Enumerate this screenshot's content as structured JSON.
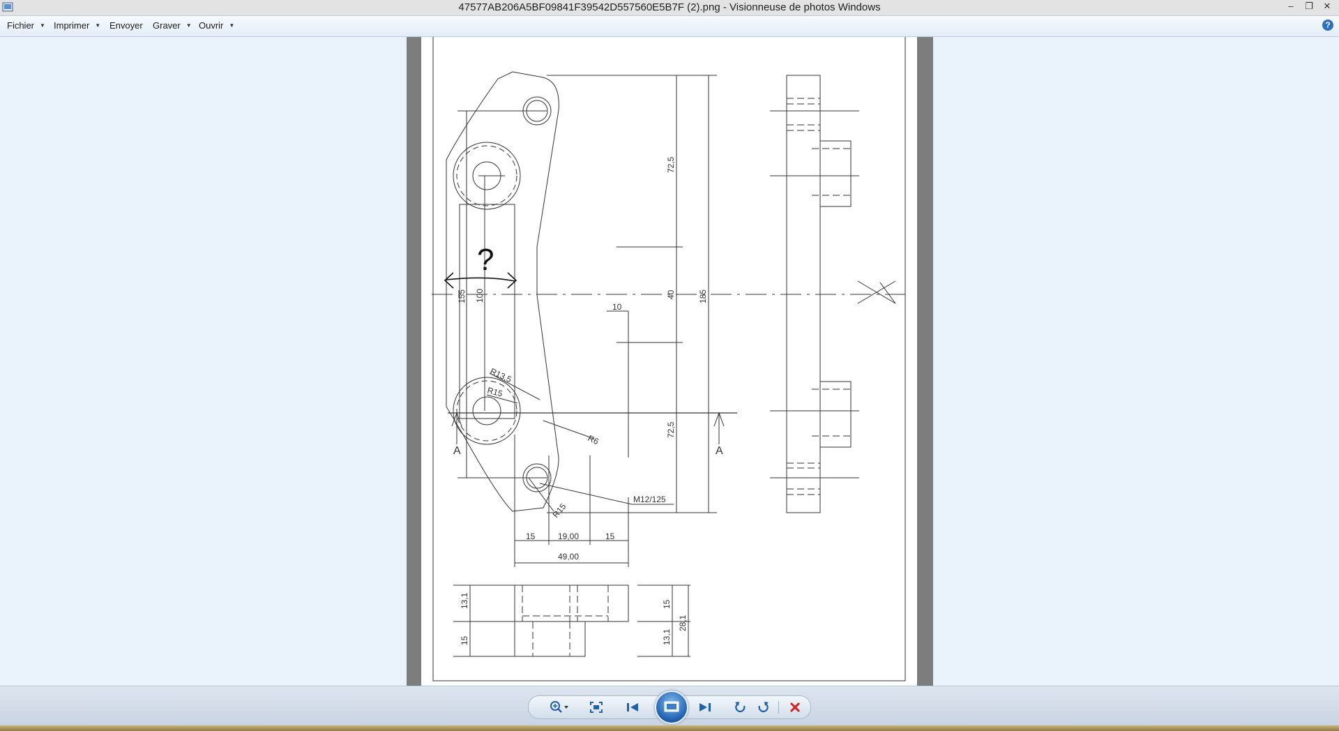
{
  "window": {
    "title": "47577AB206A5BF09841F39542D557560E5B7F (2).png - Visionneuse de photos Windows",
    "minimize_glyph": "–",
    "restore_glyph": "❐",
    "close_glyph": "✕"
  },
  "menu": {
    "items": [
      {
        "label": "Fichier",
        "has_dropdown": true
      },
      {
        "label": "Imprimer",
        "has_dropdown": true
      },
      {
        "label": "Envoyer",
        "has_dropdown": false
      },
      {
        "label": "Graver",
        "has_dropdown": true
      },
      {
        "label": "Ouvrir",
        "has_dropdown": true
      }
    ],
    "help_glyph": "?"
  },
  "drawing": {
    "dimensions": {
      "d72_5_top": "72,5",
      "d40": "40",
      "d72_5_bottom": "72,5",
      "d185": "185",
      "d155": "155",
      "d100": "100",
      "d10": "10",
      "r13_5": "R13,5",
      "r15_left": "R15",
      "r6": "R6",
      "m12": "M12/125",
      "r15_bottom": "R15",
      "d15_left": "15",
      "d19": "19,00",
      "d15_right": "15",
      "d49": "49,00",
      "d13_1_left": "13,1",
      "d15_left_v": "15",
      "d15_right_v": "15",
      "d13_1_right": "13,1",
      "d28_1": "28,1"
    },
    "section_marks": {
      "left": "A",
      "right": "A"
    },
    "annotation": "?"
  },
  "toolbar": {
    "buttons": [
      "zoom",
      "actual-size",
      "previous",
      "slideshow",
      "next",
      "rotate-left",
      "rotate-right",
      "delete"
    ]
  },
  "colors": {
    "accent_blue": "#1f5fae",
    "delete_red": "#d62020",
    "viewer_bg": "#eaf2fb"
  }
}
